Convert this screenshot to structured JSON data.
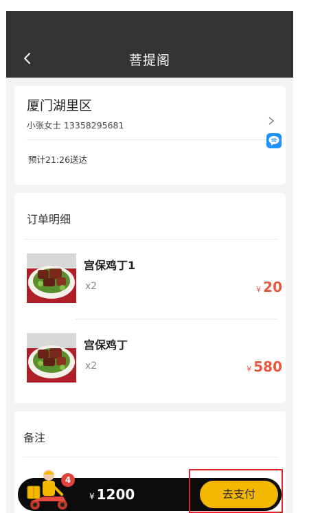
{
  "header": {
    "title": "菩提阁"
  },
  "address": {
    "title": "厦门湖里区",
    "contact": "小张女士 13358295681",
    "eta": "预计21:26送达"
  },
  "order": {
    "title": "订单明细",
    "items": [
      {
        "name": "宫保鸡丁1",
        "qty": "x2",
        "currency": "¥",
        "price": "20"
      },
      {
        "name": "宫保鸡丁",
        "qty": "x2",
        "currency": "¥",
        "price": "580"
      }
    ]
  },
  "note": {
    "title": "备注"
  },
  "cart": {
    "badge_count": "4",
    "currency": "¥",
    "total": "1200",
    "pay_label": "去支付"
  },
  "colors": {
    "navbar": "#333333",
    "price": "#e8563e",
    "pay_button": "#f5b800",
    "highlight_box": "#d9252a"
  },
  "icons": [
    "back-arrow-icon",
    "chevron-right-icon",
    "map-app-icon",
    "courier-icon",
    "food-dish-image"
  ]
}
